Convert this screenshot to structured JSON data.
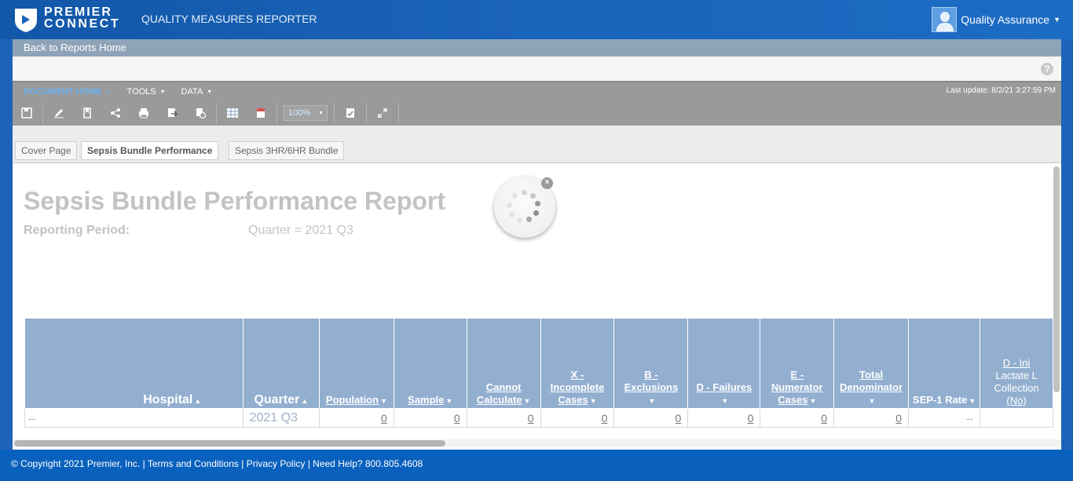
{
  "header": {
    "brand_line1": "PREMIER",
    "brand_line2": "CONNECT",
    "app_name": "QUALITY MEASURES REPORTER",
    "user_name": "Quality Assurance"
  },
  "back_link": "Back to Reports Home",
  "menu": {
    "items": [
      "DOCUMENT HOME",
      "TOOLS",
      "DATA"
    ],
    "last_update": "Last update: 8/2/21 3:27:59 PM"
  },
  "toolbar": {
    "zoom": "100%"
  },
  "tabs": [
    "Cover Page",
    "Sepsis Bundle Performance",
    "Sepsis 3HR/6HR Bundle"
  ],
  "active_tab": "Sepsis Bundle Performance",
  "report": {
    "title": "Sepsis Bundle Performance Report",
    "period_label": "Reporting Period:",
    "period_value": "Quarter = 2021 Q3"
  },
  "table": {
    "columns": [
      {
        "l1": "",
        "l2": "Hospital"
      },
      {
        "l1": "",
        "l2": "Quarter"
      },
      {
        "l1": "",
        "l2": "Population"
      },
      {
        "l1": "",
        "l2": "Sample"
      },
      {
        "l1": "Cannot",
        "l2": "Calculate"
      },
      {
        "l1": "X -",
        "l1b": "Incomplete",
        "l2": "Cases"
      },
      {
        "l1": "",
        "l2": "B - Exclusions"
      },
      {
        "l1": "",
        "l2": "D - Failures"
      },
      {
        "l1": "E -",
        "l1b": "Numerator",
        "l2": "Cases"
      },
      {
        "l1": "Total",
        "l2": "Denominator"
      },
      {
        "l1": "",
        "l2": "SEP-1 Rate"
      },
      {
        "l1": "D - Ini",
        "l1b": "Lactate L",
        "l1c": "Collection",
        "l2": "(No)"
      }
    ],
    "row": [
      "--",
      "2021 Q3",
      "0",
      "0",
      "0",
      "0",
      "0",
      "0",
      "0",
      "0",
      "--",
      ""
    ]
  },
  "footer": {
    "copyright": "© Copyright 2021 Premier, Inc.",
    "terms": "Terms and Conditions",
    "privacy": "Privacy Policy",
    "help": "Need Help? 800.805.4608"
  },
  "icons": {
    "toolbar": [
      "save-icon",
      "edit-icon",
      "bookmark-icon",
      "share-icon",
      "print-icon",
      "export-icon",
      "schedule-icon",
      "excel-icon",
      "pdf-icon",
      "refresh-icon",
      "fullscreen-icon"
    ]
  },
  "colors": {
    "brand_blue": "#1d63b8",
    "header_blue": "#93afd0",
    "toolbar_gray": "#9a9a9a"
  }
}
